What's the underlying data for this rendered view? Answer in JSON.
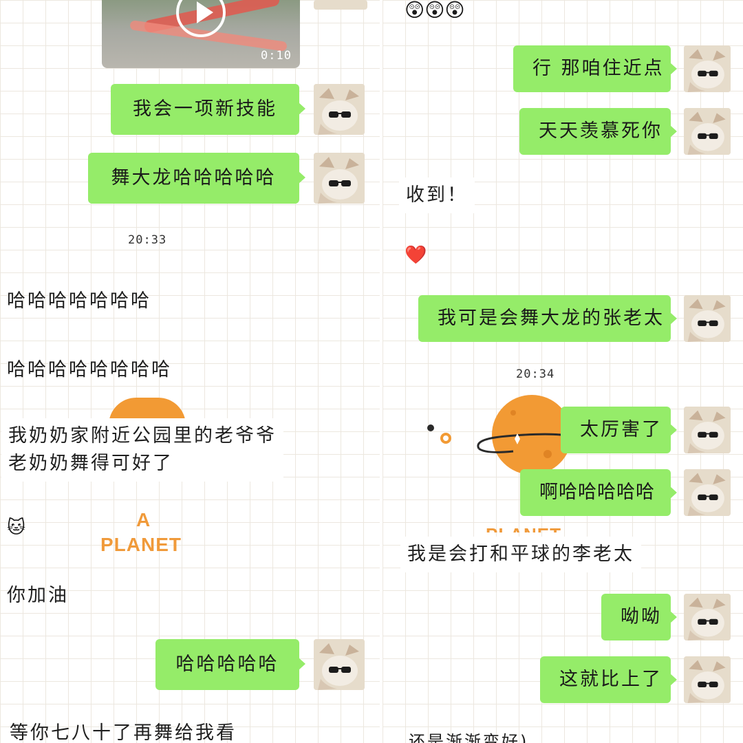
{
  "left": {
    "video_duration": "0:10",
    "messages": {
      "skill": "我会一项新技能",
      "dragon": "舞大龙哈哈哈哈哈",
      "time1": "20:33",
      "ha1": "哈哈哈哈哈哈哈",
      "ha2": "哈哈哈哈哈哈哈哈",
      "grandma1": "我奶奶家附近公园里的老爷爷",
      "grandma2": "老奶奶舞得可好了",
      "cheer": "你加油",
      "ha3": "哈哈哈哈哈",
      "wait": "等你七八十了再舞给我看"
    },
    "sticker": {
      "line1": "A",
      "line2": "PLANET"
    }
  },
  "right": {
    "messages": {
      "closer": "行 那咱住近点",
      "envy": "天天羡慕死你",
      "received": "收到！",
      "zhang": "我可是会舞大龙的张老太",
      "time2": "20:34",
      "amazing": "太厉害了",
      "aha": "啊哈哈哈哈哈",
      "li": "我是会打和平球的李老太",
      "yo": "呦呦",
      "compare": "这就比上了",
      "cut": "还是渐渐变好)"
    },
    "sticker_partial": "PLANET"
  },
  "icons": {
    "emoji_wow": "astonished-face-emoji",
    "emoji_heart": "red-heart-emoji",
    "emoji_cat": "cat-face-emoji"
  },
  "colors": {
    "sent_bubble": "#95ec69",
    "planet_orange": "#f29a34",
    "grid": "#ece7df"
  }
}
